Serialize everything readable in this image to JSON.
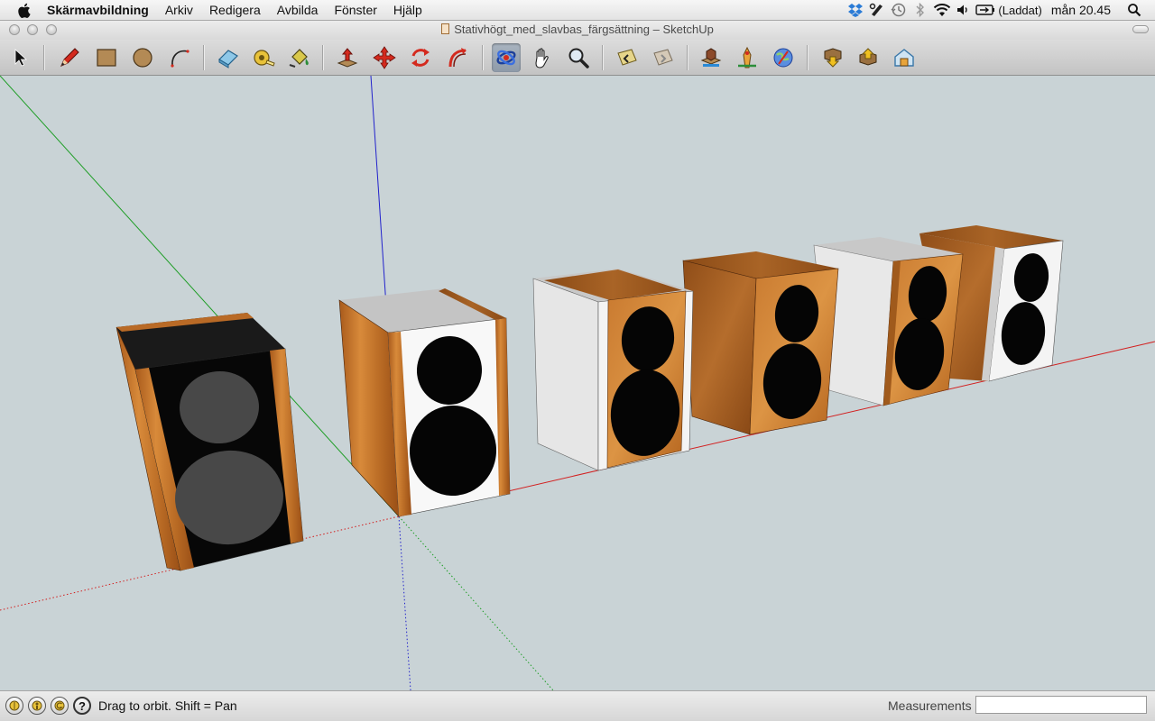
{
  "menubar": {
    "app_name": "Skärmavbildning",
    "items": [
      "Arkiv",
      "Redigera",
      "Avbilda",
      "Fönster",
      "Hjälp"
    ],
    "battery_status": "(Laddat)",
    "clock": "mån 20.45",
    "status_icons": [
      "dropbox-icon",
      "evernote-icon",
      "time-machine-icon",
      "bluetooth-icon",
      "wifi-icon",
      "volume-icon",
      "battery-icon",
      "spotlight-icon"
    ]
  },
  "window": {
    "title": "Stativhögt_med_slavbas_färgsättning – SketchUp"
  },
  "toolbar": {
    "tools": [
      "select-tool",
      "pencil-line-tool",
      "rectangle-tool",
      "circle-tool",
      "arc-tool",
      "eraser-tool",
      "tape-measure-tool",
      "paint-bucket-tool",
      "push-pull-tool",
      "move-tool",
      "rotate-tool",
      "follow-me-tool",
      "orbit-tool",
      "pan-tool",
      "zoom-tool",
      "previous-view-tool",
      "next-view-tool",
      "get-models-tool",
      "share-model-tool",
      "add-location-tool",
      "google-earth-tool",
      "get-components-tool",
      "share-component-tool",
      "extension-warehouse-tool"
    ],
    "active_tool": "orbit-tool"
  },
  "statusbar": {
    "hint": "Drag to orbit.  Shift = Pan",
    "measurements_label": "Measurements",
    "measurements_value": ""
  },
  "colors": {
    "sky": "#c9d3d6",
    "wood_light": "#c8752a",
    "wood_dark": "#8a4512",
    "white_panel": "#f4f4f4",
    "grey_panel": "#c8c8c8",
    "black_panel": "#050505",
    "x_axis": "#d22020",
    "y_axis": "#1f9e27",
    "z_axis": "#2222cc"
  },
  "scene": {
    "speakers": [
      {
        "name": "speaker-black-front",
        "front": "black",
        "cones": "grey",
        "sides": "wood"
      },
      {
        "name": "speaker-white-front",
        "front": "white",
        "cones": "black",
        "sides": "wood"
      },
      {
        "name": "speaker-grey-cabinet",
        "front": "wood",
        "cones": "black",
        "sides": "grey"
      },
      {
        "name": "speaker-wood-cabinet",
        "front": "wood",
        "cones": "black",
        "sides": "wood"
      },
      {
        "name": "speaker-grey-cabinet-2",
        "front": "wood",
        "cones": "black",
        "sides": "grey"
      },
      {
        "name": "speaker-white-front-far",
        "front": "white",
        "cones": "black",
        "sides": "wood"
      }
    ]
  }
}
